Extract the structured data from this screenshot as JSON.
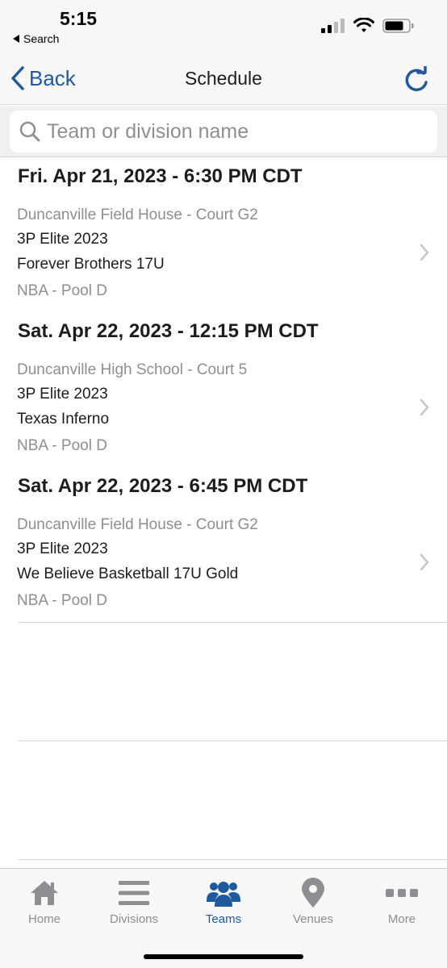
{
  "status_bar": {
    "time": "5:15",
    "back_label": "Search"
  },
  "nav": {
    "back_label": "Back",
    "title": "Schedule"
  },
  "search": {
    "placeholder": "Team or division name",
    "value": ""
  },
  "games": [
    {
      "date": "Fri. Apr 21, 2023 - 6:30 PM CDT",
      "venue": "Duncanville Field House - Court G2",
      "event": "3P Elite 2023",
      "opponent": "Forever Brothers 17U",
      "division": "NBA - Pool D"
    },
    {
      "date": "Sat. Apr 22, 2023 - 12:15 PM CDT",
      "venue": "Duncanville High School - Court 5",
      "event": "3P Elite 2023",
      "opponent": "Texas Inferno",
      "division": "NBA - Pool D"
    },
    {
      "date": "Sat. Apr 22, 2023 - 6:45 PM CDT",
      "venue": "Duncanville Field House - Court G2",
      "event": "3P Elite 2023",
      "opponent": "We Believe Basketball 17U Gold",
      "division": "NBA - Pool D"
    }
  ],
  "tabs": [
    {
      "label": "Home",
      "icon": "home-icon",
      "active": false
    },
    {
      "label": "Divisions",
      "icon": "list-icon",
      "active": false
    },
    {
      "label": "Teams",
      "icon": "people-icon",
      "active": true
    },
    {
      "label": "Venues",
      "icon": "location-pin-icon",
      "active": false
    },
    {
      "label": "More",
      "icon": "ellipsis-icon",
      "active": false
    }
  ],
  "colors": {
    "accent": "#1f5a9e",
    "inactive": "#8e8e93",
    "secondary_text": "#8e8e93"
  }
}
